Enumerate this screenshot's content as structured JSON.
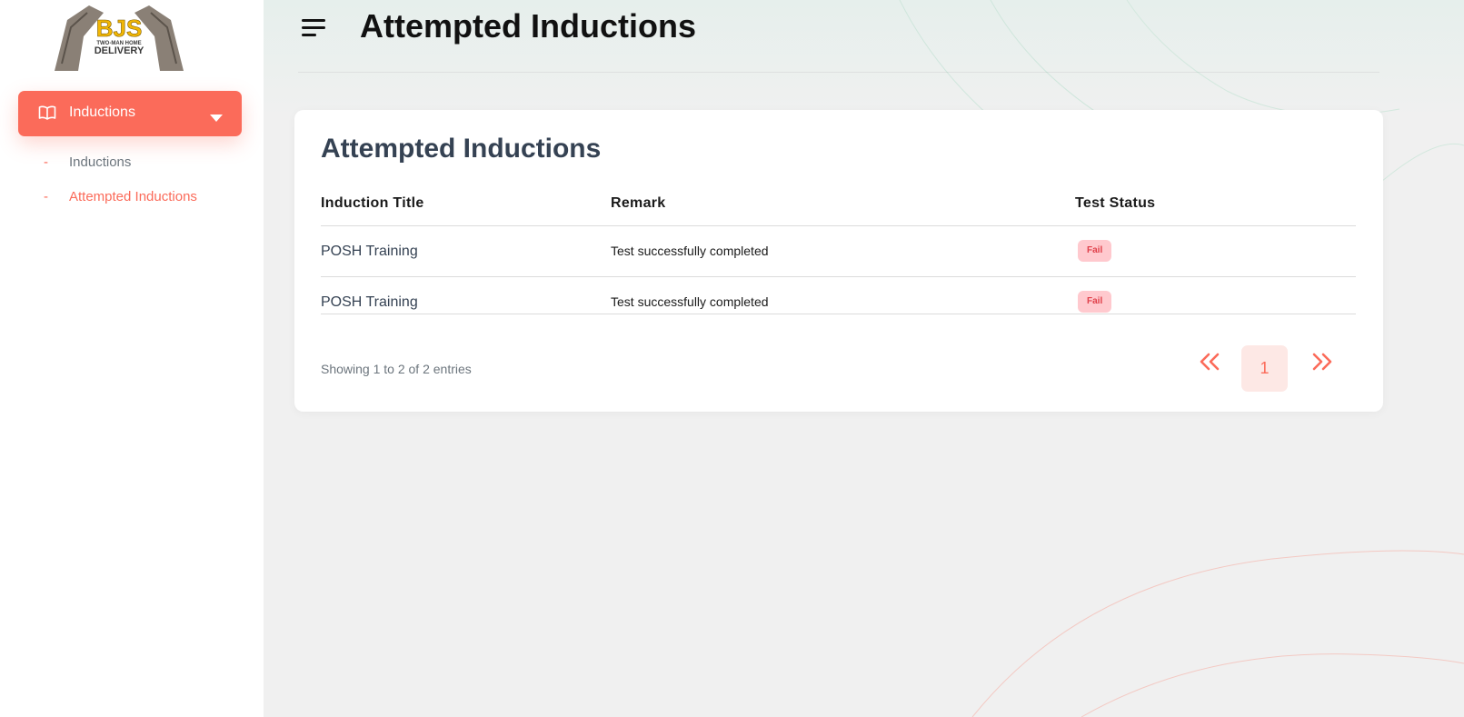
{
  "logo": {
    "text_main": "BJS",
    "text_sub": "TWO-MAN HOME",
    "text_bottom": "DELIVERY"
  },
  "sidebar": {
    "parent": {
      "label": "Inductions",
      "icon": "book-icon"
    },
    "items": [
      {
        "label": "Inductions",
        "active": false
      },
      {
        "label": "Attempted Inductions",
        "active": true
      }
    ],
    "dash": "-"
  },
  "header": {
    "title": "Attempted Inductions"
  },
  "card": {
    "title": "Attempted Inductions",
    "columns": [
      "Induction Title",
      "Remark",
      "Test Status"
    ],
    "rows": [
      {
        "title": "POSH Training",
        "remark": "Test successfully completed",
        "status": "Fail"
      },
      {
        "title": "POSH Training",
        "remark": "Test successfully completed",
        "status": "Fail"
      }
    ],
    "info": "Showing 1 to 2 of 2 entries",
    "pagination": {
      "current": "1"
    }
  },
  "colors": {
    "accent": "#fb6b5a",
    "title": "#354253",
    "badge_bg": "#ffc9ce",
    "badge_text": "#e0404a"
  }
}
